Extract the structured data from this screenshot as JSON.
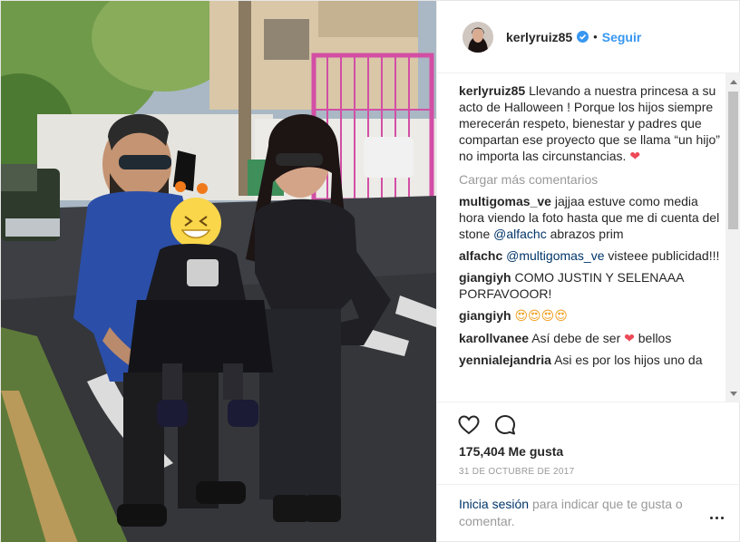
{
  "post": {
    "username": "kerlyruiz85",
    "separator": "•",
    "follow_label": "Seguir",
    "caption": {
      "author": "kerlyruiz85",
      "text": "Llevando a nuestra princesa a su acto de Halloween ! Porque los hijos siempre merecerán respeto, bienestar y padres que compartan ese proyecto que se llama “un hijo” no importa las circunstancias.",
      "heart": "❤"
    },
    "load_more_label": "Cargar más comentarios",
    "comments": [
      {
        "author": "multigomas_ve",
        "text_before": "jajjaa estuve como media hora viendo la foto hasta que me di cuenta del stone",
        "mention": "@alfachc",
        "text_after": "abrazos prim"
      },
      {
        "author": "alfachc",
        "mention": "@multigomas_ve",
        "text_after": "visteee publicidad!!!"
      },
      {
        "author": "giangiyh",
        "text": "COMO JUSTIN Y SELENAAA PORFAVOOOR!"
      },
      {
        "author": "giangiyh",
        "emojis": "😍😍😍😍"
      },
      {
        "author": "karollvanee",
        "text_before": "Así debe de ser",
        "heart": "❤",
        "text_after": "bellos"
      },
      {
        "author": "yennialejandria",
        "text": "Asi es por los hijos uno da"
      }
    ],
    "likes": "175,404 Me gusta",
    "date": "31 DE OCTUBRE DE 2017",
    "login_link": "Inicia sesión",
    "login_text": "para indicar que te gusta o comentar."
  },
  "colors": {
    "link_blue": "#3897f0",
    "username_dark": "#262626",
    "mention_blue": "#003569",
    "heart_red": "#ed4956",
    "muted_gray": "#999999",
    "jacket_blue": "#2b4fa8",
    "gate_pink": "#d24fa5"
  },
  "icons": [
    "verified-badge-icon",
    "heart-outline-icon",
    "comment-bubble-icon",
    "more-options-icon",
    "scroll-up-arrow-icon",
    "scroll-down-arrow-icon"
  ]
}
